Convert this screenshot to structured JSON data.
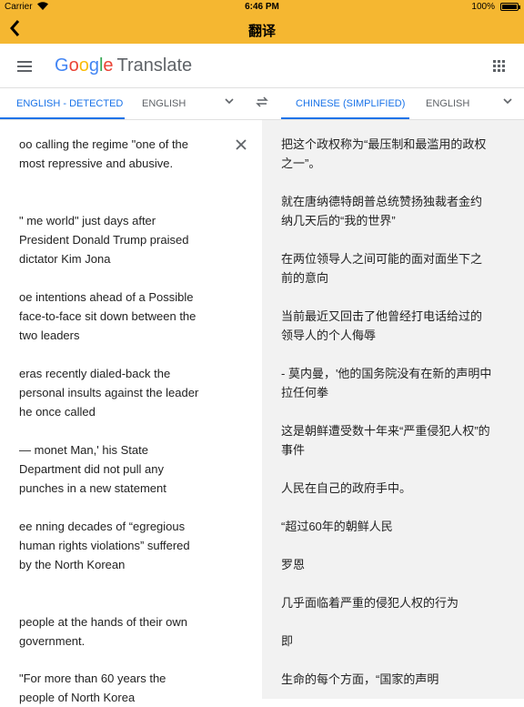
{
  "status": {
    "carrier": "Carrier",
    "time": "6:46 PM",
    "battery": "100%"
  },
  "navbar": {
    "back": "‹",
    "title": "翻译"
  },
  "header": {
    "logo": {
      "g1": "G",
      "g2": "o",
      "g3": "o",
      "g4": "g",
      "g5": "l",
      "g6": "e"
    },
    "product": "Translate"
  },
  "langbar": {
    "source_active": "ENGLISH - DETECTED",
    "source_alt": "ENGLISH",
    "target_active": "CHINESE (SIMPLIFIED)",
    "target_alt": "ENGLISH"
  },
  "source": [
    "oo calling the regime \"one of the most repressive and abusive.",
    "\" me world\" just days after President Donald Trump praised dictator Kim Jona",
    "oe intentions ahead of a Possible face-to-face sit down between the two leaders",
    "eras recently dialed-back the personal insults against the leader he once called",
    "— monet Man,' his State Department did not pull any punches in a new statement",
    "ee nning decades of “egregious human rights violations” suffered by the North Korean",
    "people at the hands of their own government.",
    "\"For more than 60 years the people of North Korea"
  ],
  "target": [
    "把这个政权称为“最压制和最滥用的政权之一”。",
    "就在唐纳德特朗普总统赞扬独裁者金约纳几天后的“我的世界”",
    "在两位领导人之间可能的面对面坐下之前的意向",
    "当前最近又回击了他曾经打电话给过的领导人的个人侮辱",
    " - 莫内曼，'他的国务院没有在新的声明中拉任何拳",
    "这是朝鲜遭受数十年来“严重侵犯人权”的事件",
    "人民在自己的政府手中。",
    "“超过60年的朝鲜人民",
    "罗恩",
    "几乎面临着严重的侵犯人权的行为",
    "即",
    "生命的每个方面，“国家的声明"
  ]
}
